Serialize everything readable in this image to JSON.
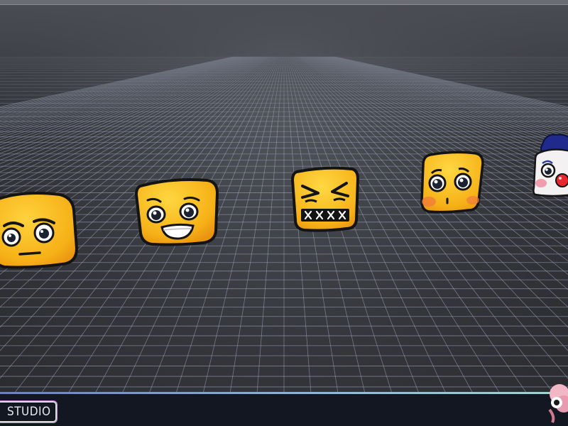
{
  "brand": {
    "name": "STUDIO"
  },
  "scene": {
    "emojis": [
      {
        "name": "suspicious-emoji-icon",
        "expression": "suspicious"
      },
      {
        "name": "grinning-emoji-icon",
        "expression": "grinning"
      },
      {
        "name": "frustrated-emoji-icon",
        "expression": "frustrated"
      },
      {
        "name": "pleading-emoji-icon",
        "expression": "pleading"
      },
      {
        "name": "clown-emoji-icon",
        "expression": "clown"
      }
    ]
  },
  "colors": {
    "grid_line": "#a9b0c8",
    "emoji_yellow": "#f7b318",
    "emoji_outline": "#141414",
    "progress_start": "#6e7fc0",
    "progress_end": "#9ed7cf",
    "footer_bg": "#131722"
  }
}
